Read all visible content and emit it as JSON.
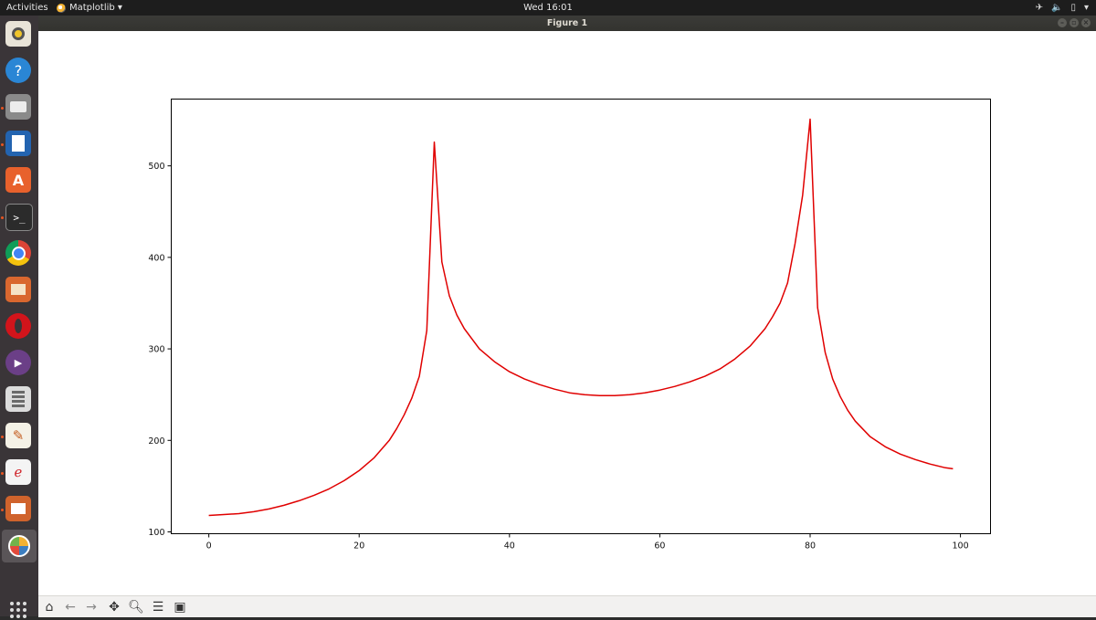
{
  "topbar": {
    "activities": "Activities",
    "app_menu": "Matplotlib ▾",
    "clock": "Wed 16:01",
    "tray_icons": [
      "airplane-icon",
      "volume-icon",
      "battery-icon",
      "system-menu-icon"
    ]
  },
  "window": {
    "title": "Figure 1"
  },
  "dock": {
    "items": [
      "rhythmbox-icon",
      "help-icon",
      "files-icon",
      "writer-icon",
      "software-icon",
      "terminal-icon",
      "chrome-icon",
      "photos-icon",
      "opera-icon",
      "player-icon",
      "calculator-icon",
      "text-editor-icon",
      "pdf-viewer-icon",
      "impress-icon",
      "python-icon"
    ],
    "show_apps": "show-applications-icon"
  },
  "toolbar": {
    "icons": [
      "home-icon",
      "back-icon",
      "forward-icon",
      "pan-icon",
      "zoom-icon",
      "configure-subplots-icon",
      "save-icon"
    ]
  },
  "chart_data": {
    "type": "line",
    "title": "",
    "xlabel": "",
    "ylabel": "",
    "xlim": [
      -5,
      104
    ],
    "ylim": [
      98,
      573
    ],
    "xticks": [
      0,
      20,
      40,
      60,
      80,
      100
    ],
    "yticks": [
      100,
      200,
      300,
      400,
      500
    ],
    "grid": false,
    "series": [
      {
        "color": "#e00000",
        "x": [
          0,
          2,
          4,
          6,
          8,
          10,
          12,
          14,
          16,
          18,
          20,
          22,
          24,
          25,
          26,
          27,
          28,
          29,
          30,
          31,
          32,
          33,
          34,
          36,
          38,
          40,
          42,
          44,
          46,
          48,
          50,
          52,
          54,
          56,
          58,
          60,
          62,
          64,
          66,
          68,
          70,
          72,
          74,
          75,
          76,
          77,
          78,
          79,
          80,
          81,
          82,
          83,
          84,
          85,
          86,
          88,
          90,
          92,
          94,
          96,
          98,
          99
        ],
        "y": [
          118,
          119,
          120,
          122,
          125,
          129,
          134,
          140,
          147,
          156,
          167,
          181,
          200,
          213,
          228,
          246,
          270,
          320,
          526,
          395,
          358,
          337,
          322,
          300,
          286,
          275,
          267,
          261,
          256,
          252,
          250,
          249,
          249,
          250,
          252,
          255,
          259,
          264,
          270,
          278,
          289,
          303,
          322,
          335,
          350,
          372,
          415,
          468,
          551,
          345,
          296,
          267,
          248,
          233,
          221,
          204,
          193,
          185,
          179,
          174,
          170,
          169
        ]
      }
    ]
  }
}
